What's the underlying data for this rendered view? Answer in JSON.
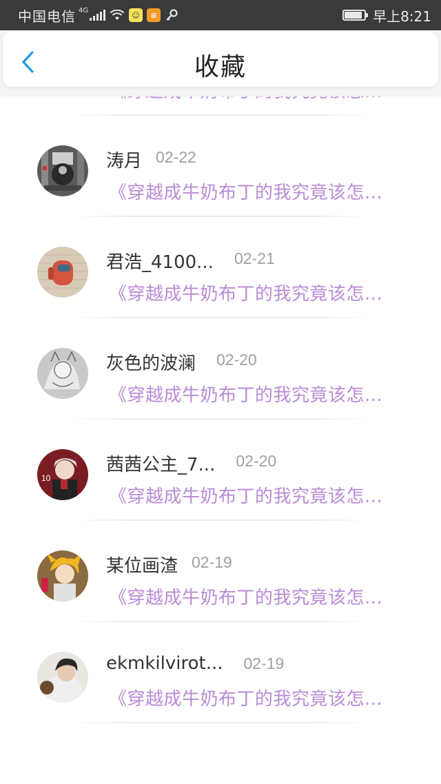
{
  "status_bar": {
    "carrier": "中国电信",
    "network": "4G",
    "time": "早上8:21",
    "battery_level": 0.9
  },
  "header": {
    "title": "收藏",
    "back_icon": "chevron-left-icon",
    "accent_color": "#1e9be8"
  },
  "favorites": [
    {
      "name": "",
      "date": "",
      "snippet": "《穿越成牛奶布丁的我究竟该怎..."
    },
    {
      "name": "涛月",
      "date": "02-22",
      "snippet": "《穿越成牛奶布丁的我究竟该怎..."
    },
    {
      "name": "君浩_4100...",
      "date": "02-21",
      "snippet": "《穿越成牛奶布丁的我究竟该怎..."
    },
    {
      "name": "灰色的波澜",
      "date": "02-20",
      "snippet": "《穿越成牛奶布丁的我究竟该怎..."
    },
    {
      "name": "茜茜公主_7...",
      "date": "02-20",
      "snippet": "《穿越成牛奶布丁的我究竟该怎..."
    },
    {
      "name": "某位画渣",
      "date": "02-19",
      "snippet": "《穿越成牛奶布丁的我究竟该怎..."
    },
    {
      "name": "ekmkilvirot...",
      "date": "02-19",
      "snippet": "《穿越成牛奶布丁的我究竟该怎..."
    }
  ],
  "colors": {
    "snippet": "#b98bd6",
    "date": "#a0a0a0",
    "name": "#333333"
  }
}
